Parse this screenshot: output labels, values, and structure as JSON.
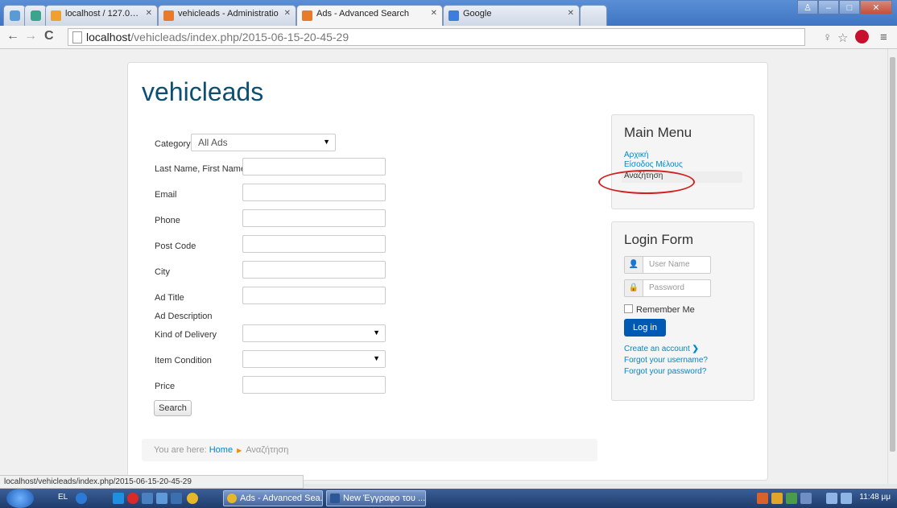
{
  "browser": {
    "tabs": [
      {
        "label": "localhost / 127.0.0.1 / vehi"
      },
      {
        "label": "vehicleads - Administratio"
      },
      {
        "label": "Ads - Advanced Search"
      },
      {
        "label": "Google"
      }
    ],
    "url_host": "localhost",
    "url_path": "/vehicleads/index.php/2015-06-15-20-45-29"
  },
  "site": {
    "title": "vehicleads"
  },
  "form": {
    "category_label": "Category",
    "category_value": "All Ads",
    "fields": [
      {
        "label": "Last Name, First Name"
      },
      {
        "label": "Email"
      },
      {
        "label": "Phone"
      },
      {
        "label": "Post Code"
      },
      {
        "label": "City"
      },
      {
        "label": "Ad Title"
      },
      {
        "label": "Ad Description"
      },
      {
        "label": "Kind of Delivery"
      },
      {
        "label": "Item Condition"
      },
      {
        "label": "Price"
      }
    ],
    "search_label": "Search"
  },
  "breadcrumb": {
    "prefix": "You are here:",
    "home": "Home",
    "current": "Αναζήτηση"
  },
  "main_menu": {
    "title": "Main Menu",
    "items": [
      "Αρχική",
      "Είσοδος Μέλους",
      "Αναζήτηση"
    ]
  },
  "login": {
    "title": "Login Form",
    "username_placeholder": "User Name",
    "password_placeholder": "Password",
    "remember_label": "Remember Me",
    "login_button": "Log in",
    "create_account": "Create an account",
    "forgot_username": "Forgot your username?",
    "forgot_password": "Forgot your password?"
  },
  "status_bar": "localhost/vehicleads/index.php/2015-06-15-20-45-29",
  "taskbar": {
    "language": "EL",
    "tasks": [
      "Ads - Advanced Sea...",
      "New Έγγραφο του ..."
    ],
    "clock": "11:48 μμ"
  },
  "colors": {
    "brand": "#0d4f72",
    "link": "#0088cc",
    "login_button": "#0059b3",
    "highlight_ellipse": "#d21f1f"
  }
}
